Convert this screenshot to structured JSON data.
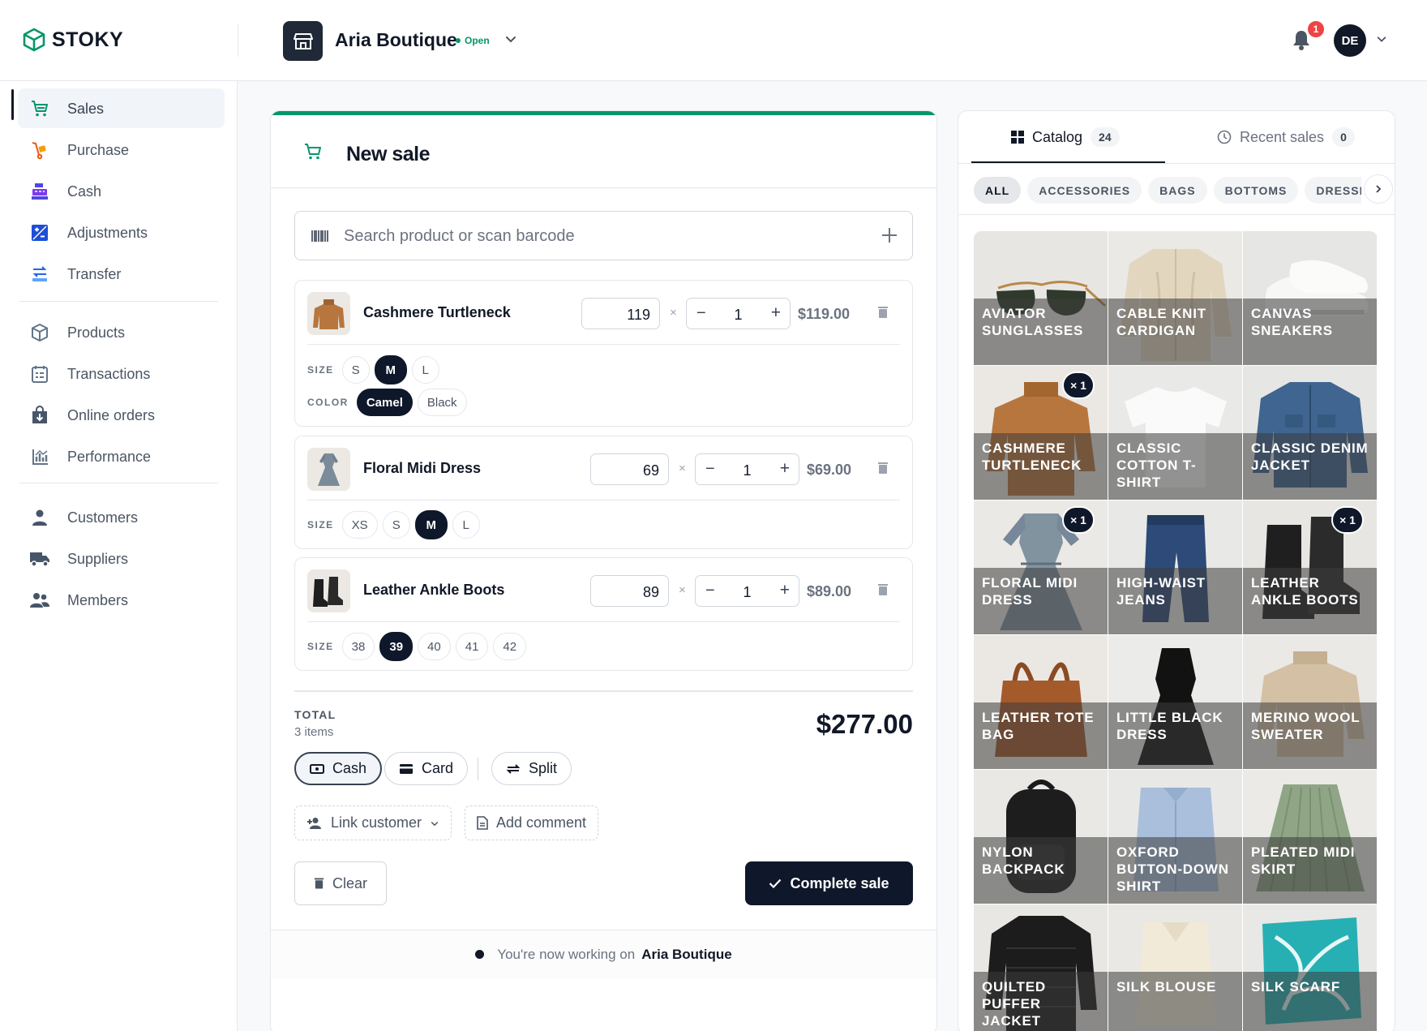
{
  "app": {
    "name": "STOKY"
  },
  "store": {
    "name": "Aria Boutique",
    "status": "Open"
  },
  "header": {
    "notifications_count": "1",
    "user_initials": "DE"
  },
  "sidebar": {
    "items": [
      {
        "label": "Sales",
        "icon": "cart-icon",
        "active": true
      },
      {
        "label": "Purchase",
        "icon": "hand-truck-icon"
      },
      {
        "label": "Cash",
        "icon": "cash-register-icon"
      },
      {
        "label": "Adjustments",
        "icon": "plus-minus-icon"
      },
      {
        "label": "Transfer",
        "icon": "transfer-icon"
      },
      {
        "label": "Products",
        "icon": "box-icon"
      },
      {
        "label": "Transactions",
        "icon": "calendar-list-icon"
      },
      {
        "label": "Online orders",
        "icon": "online-bag-icon"
      },
      {
        "label": "Performance",
        "icon": "chart-icon"
      },
      {
        "label": "Customers",
        "icon": "user-icon"
      },
      {
        "label": "Suppliers",
        "icon": "truck-icon"
      },
      {
        "label": "Members",
        "icon": "users-icon"
      }
    ]
  },
  "sale": {
    "title": "New sale",
    "search_placeholder": "Search product or scan barcode",
    "items": [
      {
        "name": "Cashmere Turtleneck",
        "price": "119",
        "qty": "1",
        "total": "$119.00",
        "size_label": "SIZE",
        "sizes": [
          "S",
          "M",
          "L"
        ],
        "size_selected": "M",
        "color_label": "COLOR",
        "colors": [
          "Camel",
          "Black"
        ],
        "color_selected": "Camel"
      },
      {
        "name": "Floral Midi Dress",
        "price": "69",
        "qty": "1",
        "total": "$69.00",
        "size_label": "SIZE",
        "sizes": [
          "XS",
          "S",
          "M",
          "L"
        ],
        "size_selected": "M"
      },
      {
        "name": "Leather Ankle Boots",
        "price": "89",
        "qty": "1",
        "total": "$89.00",
        "size_label": "SIZE",
        "sizes": [
          "38",
          "39",
          "40",
          "41",
          "42"
        ],
        "size_selected": "39"
      }
    ],
    "total_label": "TOTAL",
    "items_count": "3 items",
    "total": "$277.00",
    "payment": {
      "cash": "Cash",
      "card": "Card",
      "split": "Split",
      "selected": "Cash"
    },
    "link_customer": "Link customer",
    "add_comment": "Add comment",
    "clear": "Clear",
    "complete": "Complete sale",
    "footer_prefix": "You're now working on",
    "footer_store": "Aria Boutique"
  },
  "catalog": {
    "tabs": [
      {
        "label": "Catalog",
        "count": "24",
        "active": true
      },
      {
        "label": "Recent sales",
        "count": "0"
      }
    ],
    "categories": [
      "ALL",
      "ACCESSORIES",
      "BAGS",
      "BOTTOMS",
      "DRESSES"
    ],
    "category_selected": "ALL",
    "products": [
      {
        "name": "Aviator Sunglasses"
      },
      {
        "name": "Cable Knit Cardigan"
      },
      {
        "name": "Canvas Sneakers"
      },
      {
        "name": "Cashmere Turtleneck",
        "in_cart": "× 1"
      },
      {
        "name": "Classic Cotton T-Shirt"
      },
      {
        "name": "Classic Denim Jacket"
      },
      {
        "name": "Floral Midi Dress",
        "in_cart": "× 1"
      },
      {
        "name": "High-Waist Jeans"
      },
      {
        "name": "Leather Ankle Boots",
        "in_cart": "× 1"
      },
      {
        "name": "Leather Tote Bag"
      },
      {
        "name": "Little Black Dress"
      },
      {
        "name": "Merino Wool Sweater"
      },
      {
        "name": "Nylon Backpack"
      },
      {
        "name": "Oxford Button-Down Shirt"
      },
      {
        "name": "Pleated Midi Skirt"
      },
      {
        "name": "Quilted Puffer Jacket"
      },
      {
        "name": "Silk Blouse"
      },
      {
        "name": "Silk Scarf"
      }
    ]
  },
  "colors": {
    "accent": "#059669",
    "dark": "#0f172a",
    "badge": "#ef4444"
  }
}
